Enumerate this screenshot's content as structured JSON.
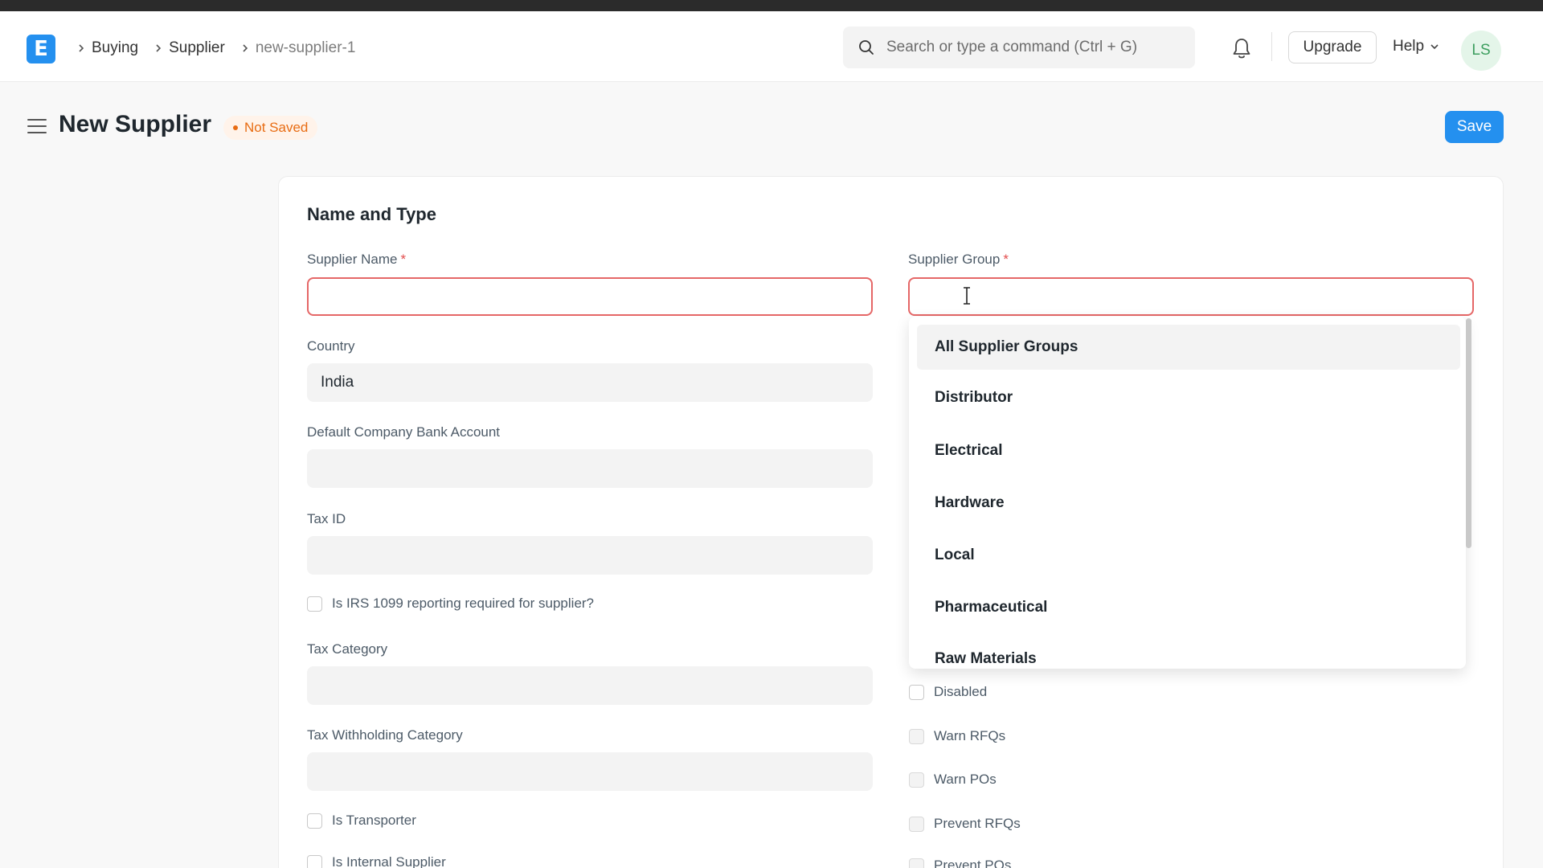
{
  "breadcrumb": [
    "Buying",
    "Supplier",
    "new-supplier-1"
  ],
  "search": {
    "placeholder": "Search or type a command (Ctrl + G)"
  },
  "navbar": {
    "upgrade_label": "Upgrade",
    "help_label": "Help",
    "avatar_initials": "LS",
    "logo_letter": "E"
  },
  "page": {
    "title": "New Supplier",
    "status": "Not Saved",
    "save_label": "Save"
  },
  "form": {
    "section_title": "Name and Type",
    "supplier_name": {
      "label": "Supplier Name",
      "required": "*",
      "value": ""
    },
    "supplier_group": {
      "label": "Supplier Group",
      "required": "*",
      "value": ""
    },
    "country": {
      "label": "Country",
      "value": "India"
    },
    "default_bank_account": {
      "label": "Default Company Bank Account",
      "value": ""
    },
    "tax_id": {
      "label": "Tax ID",
      "value": ""
    },
    "irs_1099": {
      "label": "Is IRS 1099 reporting required for supplier?",
      "checked": false
    },
    "tax_category": {
      "label": "Tax Category",
      "value": ""
    },
    "tax_withholding_category": {
      "label": "Tax Withholding Category",
      "value": ""
    },
    "is_transporter": {
      "label": "Is Transporter",
      "checked": false
    },
    "is_internal_supplier": {
      "label": "Is Internal Supplier",
      "checked": false
    },
    "disabled": {
      "label": "Disabled",
      "checked": false
    },
    "warn_rfqs": {
      "label": "Warn RFQs",
      "checked": false
    },
    "warn_pos": {
      "label": "Warn POs",
      "checked": false
    },
    "prevent_rfqs": {
      "label": "Prevent RFQs",
      "checked": false
    },
    "prevent_pos": {
      "label": "Prevent POs",
      "checked": false
    }
  },
  "supplier_group_options": [
    "All Supplier Groups",
    "Distributor",
    "Electrical",
    "Hardware",
    "Local",
    "Pharmaceutical",
    "Raw Materials"
  ],
  "colors": {
    "primary": "#2490ef",
    "error_border": "#e56767",
    "status_orange": "#e86c13"
  }
}
